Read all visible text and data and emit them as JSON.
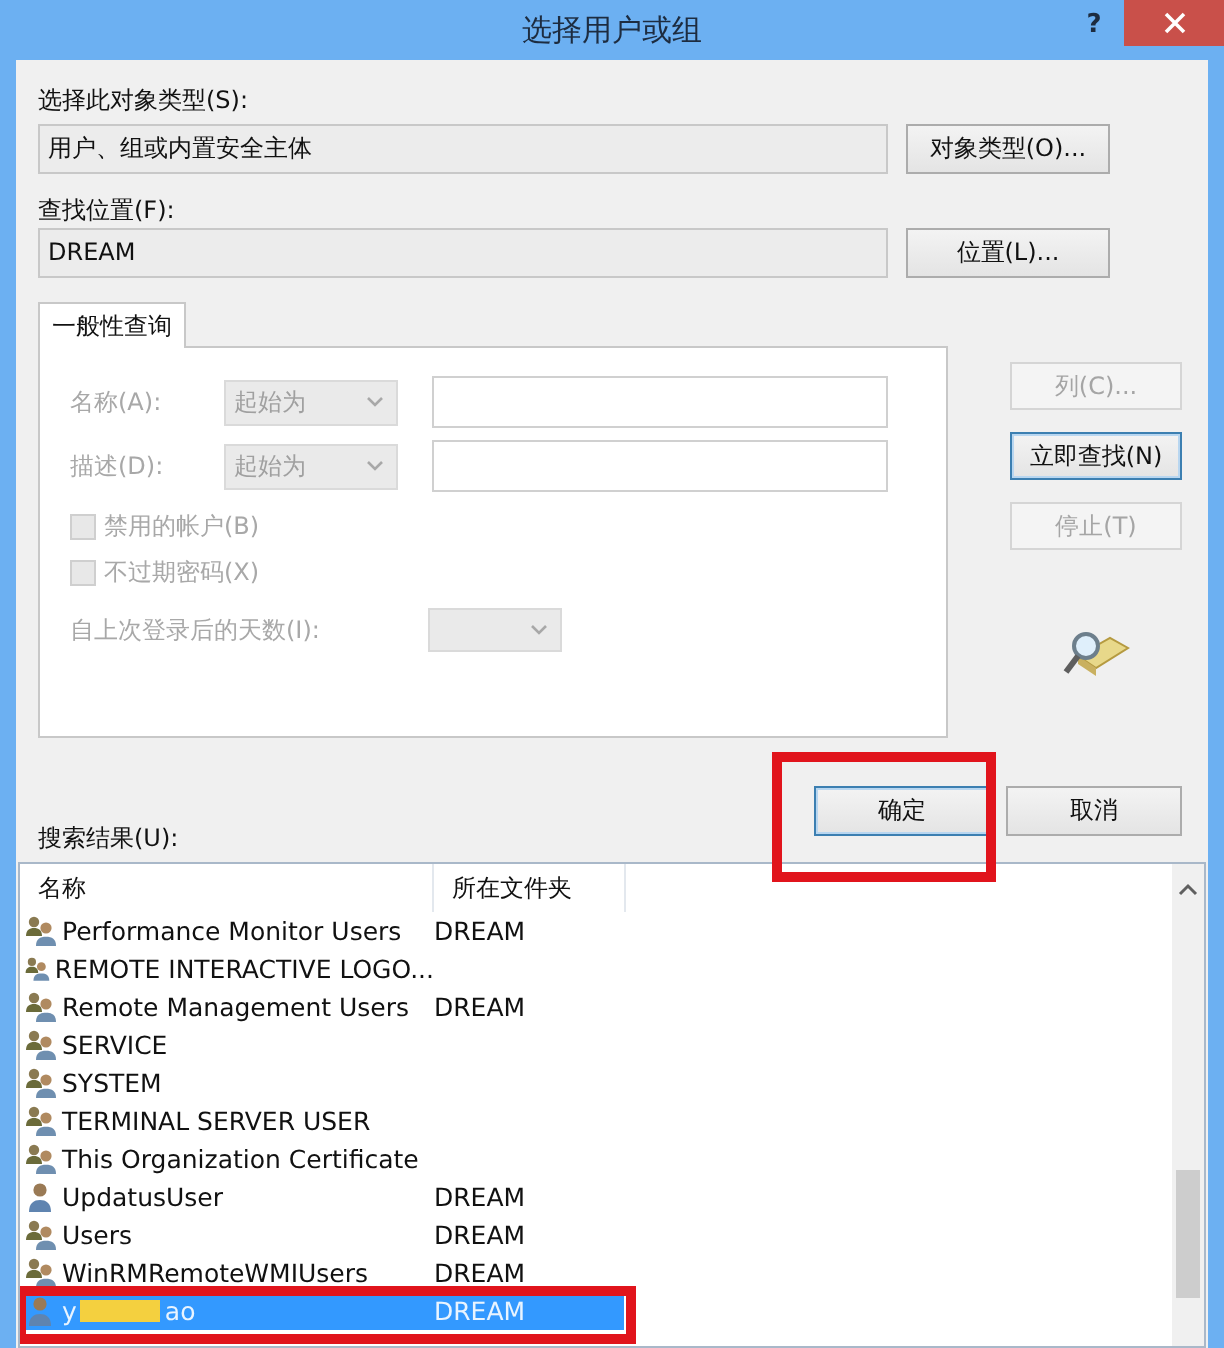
{
  "window": {
    "title": "选择用户或组",
    "help": "?"
  },
  "object_type": {
    "label": "选择此对象类型(S):",
    "value": "用户、组或内置安全主体",
    "button": "对象类型(O)..."
  },
  "location": {
    "label": "查找位置(F):",
    "value": "DREAM",
    "button": "位置(L)..."
  },
  "query": {
    "tab": {
      "label": "一般性查询",
      "selected": true
    },
    "fields": [
      {
        "label": "名称(A):",
        "mode": "起始为",
        "disabled": true
      },
      {
        "label": "描述(D):",
        "mode": "起始为",
        "disabled": true
      }
    ],
    "checkboxes": [
      {
        "label": "禁用的帐户(B)",
        "checked": false,
        "disabled": true
      },
      {
        "label": "不过期密码(X)",
        "checked": false,
        "disabled": true
      }
    ],
    "days": {
      "label": "自上次登录后的天数(I):",
      "disabled": true
    }
  },
  "side_buttons": [
    {
      "label": "列(C)...",
      "disabled": true,
      "default": false
    },
    {
      "label": "立即查找(N)",
      "disabled": false,
      "default": true
    },
    {
      "label": "停止(T)",
      "disabled": true,
      "default": false
    }
  ],
  "dialog_buttons": [
    {
      "label": "确定",
      "default": true,
      "highlighted": true
    },
    {
      "label": "取消",
      "default": false,
      "highlighted": false
    }
  ],
  "results": {
    "label": "搜索结果(U):",
    "columns": [
      "名称",
      "所在文件夹"
    ],
    "rows": [
      {
        "kind": "group",
        "name": "Performance Monitor Users",
        "folder": "DREAM",
        "selected": false,
        "highlighted": false,
        "redacted": false
      },
      {
        "kind": "group",
        "name": "REMOTE INTERACTIVE LOGO...",
        "selected": false,
        "highlighted": false,
        "redacted": false
      },
      {
        "kind": "group",
        "name": "Remote Management Users",
        "folder": "DREAM",
        "selected": false,
        "highlighted": false,
        "redacted": false
      },
      {
        "kind": "group",
        "name": "SERVICE",
        "selected": false,
        "highlighted": false,
        "redacted": false
      },
      {
        "kind": "group",
        "name": "SYSTEM",
        "selected": false,
        "highlighted": false,
        "redacted": false
      },
      {
        "kind": "group",
        "name": "TERMINAL SERVER USER",
        "selected": false,
        "highlighted": false,
        "redacted": false
      },
      {
        "kind": "group",
        "name": "This Organization Certificate",
        "selected": false,
        "highlighted": false,
        "redacted": false
      },
      {
        "kind": "user",
        "name": "UpdatusUser",
        "folder": "DREAM",
        "selected": false,
        "highlighted": false,
        "redacted": false
      },
      {
        "kind": "group",
        "name": "Users",
        "folder": "DREAM",
        "selected": false,
        "highlighted": false,
        "redacted": false
      },
      {
        "kind": "group",
        "name": "WinRMRemoteWMIUsers",
        "folder": "DREAM",
        "selected": false,
        "highlighted": false,
        "redacted": false
      },
      {
        "kind": "user",
        "name": "y",
        "name_end": "ao",
        "folder": "DREAM",
        "selected": true,
        "highlighted": true,
        "redacted": true
      }
    ]
  }
}
